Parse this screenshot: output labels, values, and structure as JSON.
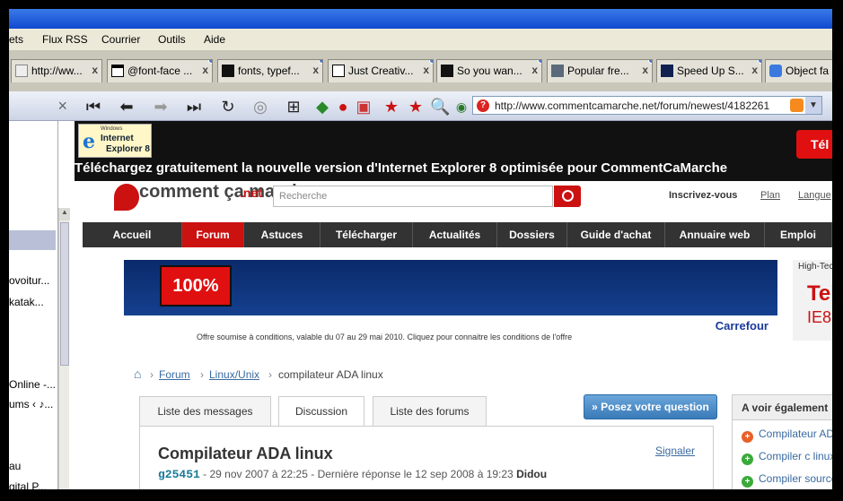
{
  "menu": [
    "ets",
    "Flux RSS",
    "Courrier",
    "Outils",
    "Aide"
  ],
  "tabs": [
    {
      "label": "http://ww...",
      "icon": "page-icon"
    },
    {
      "label": "@font-face ...",
      "icon": "page-icon"
    },
    {
      "label": "fonts, typef...",
      "icon": "ilt-icon"
    },
    {
      "label": "Just Creativ...",
      "icon": "jcd-icon"
    },
    {
      "label": "So you wan...",
      "icon": "ilt-icon"
    },
    {
      "label": "Popular fre...",
      "icon": "f-icon"
    },
    {
      "label": "Speed Up S...",
      "icon": "speed-icon"
    },
    {
      "label": "Object fa",
      "icon": "google-icon"
    }
  ],
  "url": "http://www.commentcamarche.net/forum/newest/4182261",
  "sidebar_items": [
    "",
    "ovoitur...",
    "katak...",
    "",
    "Online -...",
    "ums ‹ ♪...",
    "",
    "au",
    "gital P..."
  ],
  "ie_banner": {
    "logo_small": "Windows",
    "logo_line1": "Internet",
    "logo_line2": "Explorer 8",
    "message": "Téléchargez gratuitement la nouvelle version d'Internet Explorer 8 optimisée pour CommentCaMarche",
    "button": "Tél"
  },
  "site_logo": {
    "line": "comment ça marche",
    "net": ".net"
  },
  "search_placeholder": "Recherche",
  "top_links": [
    "Inscrivez-vous",
    "Plan",
    "Langue"
  ],
  "nav": [
    "Accueil",
    "Forum",
    "Astuces",
    "Télécharger",
    "Actualités",
    "Dossiers",
    "Guide d'achat",
    "Annuaire web",
    "Emploi"
  ],
  "ad": {
    "percent": "100%",
    "brand": "Carrefour",
    "footnote": "Offre soumise à conditions, valable du 07 au 29 mai 2010. Cliquez pour connaitre les conditions de l'offre"
  },
  "right_ad": {
    "top": "High-Tech",
    "big": "Tel",
    "sub": "IE8"
  },
  "breadcrumb": [
    "Forum",
    "Linux/Unix",
    "compilateur ADA linux"
  ],
  "page_tabs": [
    "Liste des messages",
    "Discussion",
    "Liste des forums"
  ],
  "ask_button": "» Posez votre question",
  "post": {
    "title": "Compilateur ADA linux",
    "report": "Signaler",
    "user": "g25451",
    "meta": " - 29 nov 2007 à 22:25 - Dernière réponse le 12 sep 2008 à 19:23 ",
    "last_user": "Didou"
  },
  "aside": {
    "head": "A voir également",
    "items": [
      "Compilateur AD",
      "Compiler c linux",
      "Compiler source"
    ]
  }
}
